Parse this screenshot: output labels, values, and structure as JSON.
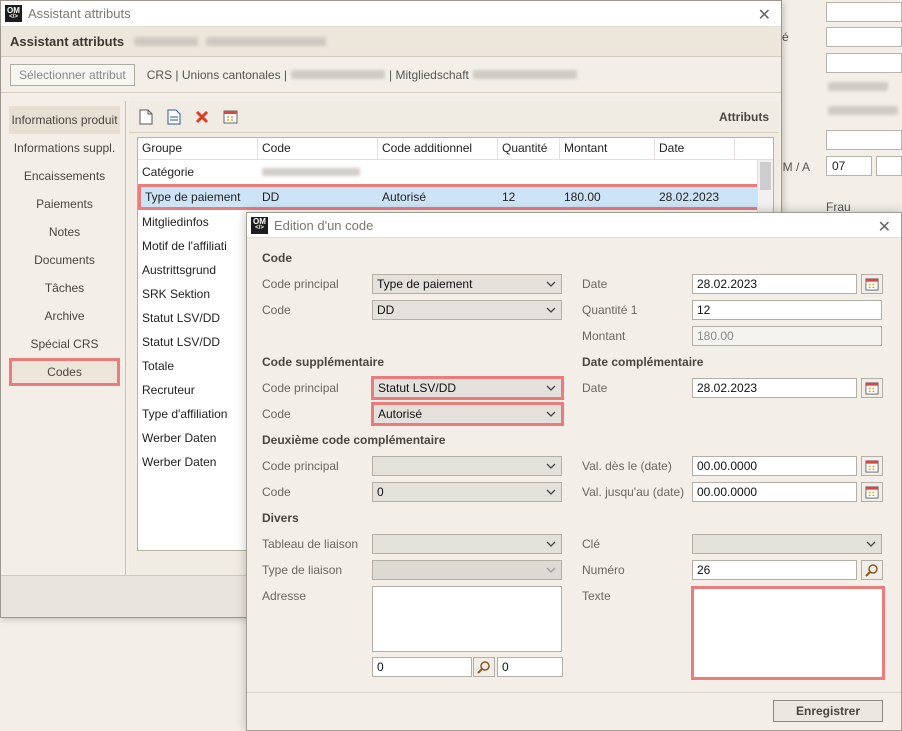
{
  "background": {
    "labels": {
      "ve": "vé",
      "dmy": "/ M / A",
      "frau": "Frau"
    },
    "day_value": "07"
  },
  "assistant": {
    "window_title": "Assistant attributs",
    "header_title": "Assistant attributs",
    "select_button": "Sélectionner attribut",
    "breadcrumb": {
      "part1": "CRS | Unions cantonales |",
      "part2": "| Mitgliedschaft"
    },
    "nav": [
      "Informations produit",
      "Informations suppl.",
      "Encaissements",
      "Paiements",
      "Notes",
      "Documents",
      "Tâches",
      "Archive",
      "Spécial CRS",
      "Codes"
    ],
    "panel_title": "Attributs",
    "table": {
      "headers": [
        "Groupe",
        "Code",
        "Code additionnel",
        "Quantité",
        "Montant",
        "Date"
      ],
      "rows": [
        {
          "group": "Catégorie",
          "code": "",
          "additional": "",
          "qty": "",
          "amount": "",
          "date": ""
        },
        {
          "group": "Type de paiement",
          "code": "DD",
          "additional": "Autorisé",
          "qty": "12",
          "amount": "180.00",
          "date": "28.02.2023"
        },
        {
          "group": "Mitgliedinfos",
          "code": "",
          "additional": "",
          "qty": "",
          "amount": "",
          "date": ""
        },
        {
          "group": "Motif de l'affiliati",
          "code": "",
          "additional": "",
          "qty": "",
          "amount": "",
          "date": ""
        },
        {
          "group": "Austrittsgrund",
          "code": "",
          "additional": "",
          "qty": "",
          "amount": "",
          "date": ""
        },
        {
          "group": "SRK Sektion",
          "code": "",
          "additional": "",
          "qty": "",
          "amount": "",
          "date": ""
        },
        {
          "group": "Statut LSV/DD",
          "code": "",
          "additional": "",
          "qty": "",
          "amount": "",
          "date": ""
        },
        {
          "group": "Statut LSV/DD",
          "code": "",
          "additional": "",
          "qty": "",
          "amount": "",
          "date": ""
        },
        {
          "group": "Totale",
          "code": "",
          "additional": "",
          "qty": "",
          "amount": "",
          "date": ""
        },
        {
          "group": "Recruteur",
          "code": "",
          "additional": "",
          "qty": "",
          "amount": "",
          "date": ""
        },
        {
          "group": "Type d'affiliation",
          "code": "",
          "additional": "",
          "qty": "",
          "amount": "",
          "date": ""
        },
        {
          "group": "Werber Daten",
          "code": "",
          "additional": "",
          "qty": "",
          "amount": "",
          "date": ""
        },
        {
          "group": "Werber Daten",
          "code": "",
          "additional": "",
          "qty": "",
          "amount": "",
          "date": ""
        }
      ]
    }
  },
  "dialog": {
    "title": "Edition d'un code",
    "sections": {
      "code": "Code",
      "supp": "Code supplémentaire",
      "date_comp": "Date complémentaire",
      "second": "Deuxième code complémentaire",
      "misc": "Divers"
    },
    "labels": {
      "main_code": "Code principal",
      "code": "Code",
      "date": "Date",
      "qty1": "Quantité 1",
      "amount": "Montant",
      "valid_from": "Val. dès le (date)",
      "valid_to": "Val. jusqu'au (date)",
      "link_table": "Tableau de liaison",
      "link_type": "Type de liaison",
      "address": "Adresse",
      "key": "Clé",
      "number": "Numéro",
      "text": "Texte"
    },
    "values": {
      "main_code": "Type de paiement",
      "code": "DD",
      "date": "28.02.2023",
      "qty1": "12",
      "amount": "180.00",
      "supp_main_code": "Statut LSV/DD",
      "supp_code": "Autorisé",
      "supp_date": "28.02.2023",
      "second_main_code": "",
      "second_code": "0",
      "valid_from": "00.00.0000",
      "valid_to": "00.00.0000",
      "link_table": "",
      "link_type": "",
      "key": "",
      "number": "26",
      "address_num1": "0",
      "address_num2": "0"
    },
    "save_button": "Enregistrer"
  },
  "colors": {
    "highlight": "#ec7c7c",
    "selected_row": "#cde4f7",
    "window_bg": "#f3efe8"
  }
}
